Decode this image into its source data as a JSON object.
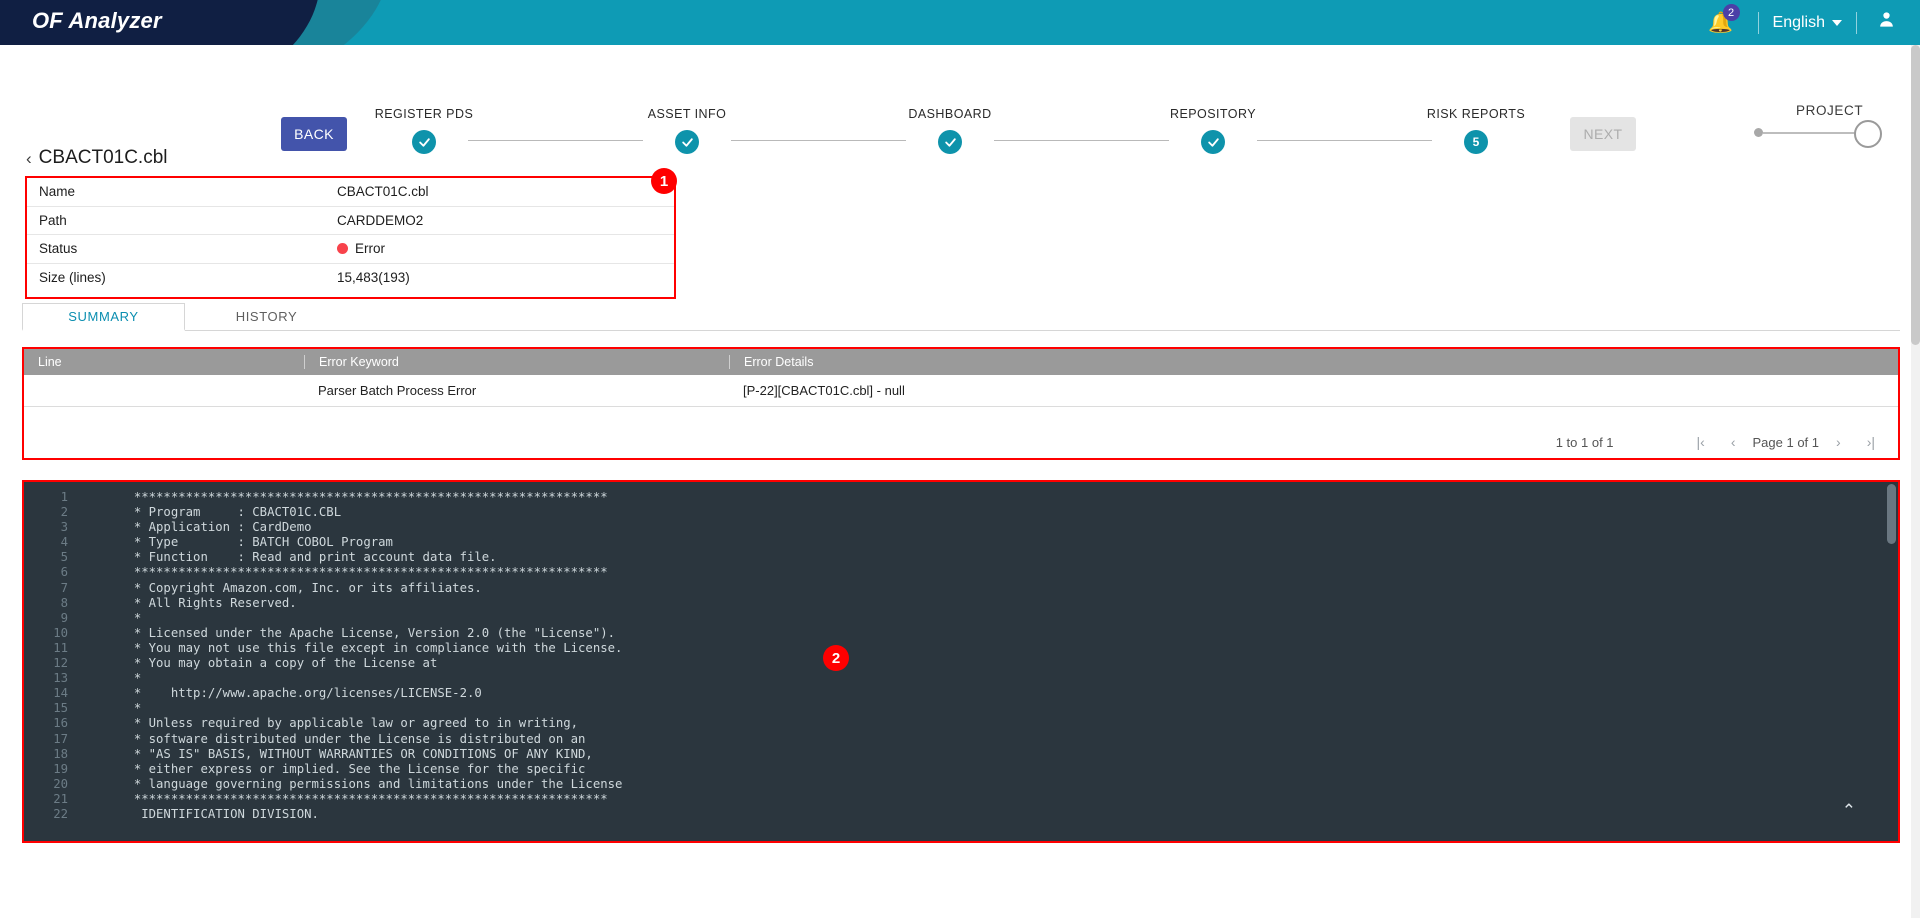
{
  "app": {
    "brand": "OF Analyzer",
    "notifications_count": "2",
    "language": "English",
    "icons": {
      "bell": "bell-icon",
      "user": "user-icon",
      "caret": "chevron-down-icon"
    }
  },
  "stepper": {
    "back_label": "BACK",
    "next_label": "NEXT",
    "steps": [
      {
        "label": "REGISTER PDS",
        "state": "done",
        "marker": "✓"
      },
      {
        "label": "ASSET INFO",
        "state": "done",
        "marker": "✓"
      },
      {
        "label": "DASHBOARD",
        "state": "done",
        "marker": "✓"
      },
      {
        "label": "REPOSITORY",
        "state": "done",
        "marker": "✓"
      },
      {
        "label": "RISK REPORTS",
        "state": "current",
        "marker": "5"
      }
    ],
    "project_toggle_label": "PROJECT"
  },
  "file": {
    "title": "CBACT01C.cbl",
    "back_chevron": "‹",
    "info_rows": [
      {
        "key": "Name",
        "value": "CBACT01C.cbl",
        "status": false
      },
      {
        "key": "Path",
        "value": "CARDDEMO2",
        "status": false
      },
      {
        "key": "Status",
        "value": "Error",
        "status": true
      },
      {
        "key": "Size (lines)",
        "value": "15,483(193)",
        "status": false
      }
    ],
    "status_color": "#f8424b"
  },
  "tabs": [
    {
      "label": "SUMMARY",
      "active": true
    },
    {
      "label": "HISTORY",
      "active": false
    }
  ],
  "error_table": {
    "columns": [
      "Line",
      "Error Keyword",
      "Error Details"
    ],
    "rows": [
      {
        "line": "",
        "keyword": "Parser Batch Process Error",
        "details": "[P-22][CBACT01C.cbl] - null"
      }
    ],
    "pager": {
      "count_text": "1 to 1 of 1",
      "first": "|‹",
      "prev": "‹",
      "page_text": "Page 1 of 1",
      "next": "›",
      "last": "›|"
    }
  },
  "code": {
    "lines": [
      {
        "n": "1",
        "t": "       ****************************************************************"
      },
      {
        "n": "2",
        "t": "       * Program     : CBACT01C.CBL"
      },
      {
        "n": "3",
        "t": "       * Application : CardDemo"
      },
      {
        "n": "4",
        "t": "       * Type        : BATCH COBOL Program"
      },
      {
        "n": "5",
        "t": "       * Function    : Read and print account data file."
      },
      {
        "n": "6",
        "t": "       ****************************************************************"
      },
      {
        "n": "7",
        "t": "       * Copyright Amazon.com, Inc. or its affiliates."
      },
      {
        "n": "8",
        "t": "       * All Rights Reserved."
      },
      {
        "n": "9",
        "t": "       *"
      },
      {
        "n": "10",
        "t": "       * Licensed under the Apache License, Version 2.0 (the \"License\")."
      },
      {
        "n": "11",
        "t": "       * You may not use this file except in compliance with the License."
      },
      {
        "n": "12",
        "t": "       * You may obtain a copy of the License at"
      },
      {
        "n": "13",
        "t": "       *"
      },
      {
        "n": "14",
        "t": "       *    http://www.apache.org/licenses/LICENSE-2.0"
      },
      {
        "n": "15",
        "t": "       *"
      },
      {
        "n": "16",
        "t": "       * Unless required by applicable law or agreed to in writing,"
      },
      {
        "n": "17",
        "t": "       * software distributed under the License is distributed on an"
      },
      {
        "n": "18",
        "t": "       * \"AS IS\" BASIS, WITHOUT WARRANTIES OR CONDITIONS OF ANY KIND,"
      },
      {
        "n": "19",
        "t": "       * either express or implied. See the License for the specific"
      },
      {
        "n": "20",
        "t": "       * language governing permissions and limitations under the License"
      },
      {
        "n": "21",
        "t": "       ****************************************************************"
      },
      {
        "n": "22",
        "t": "        IDENTIFICATION DIVISION."
      }
    ],
    "collapse_icon": "⌃"
  },
  "annotations": [
    {
      "id": "1",
      "label": "1"
    },
    {
      "id": "2",
      "label": "2"
    }
  ],
  "colors": {
    "brand_teal": "#0e9bb5",
    "brand_navy": "#101f43",
    "accent_red": "#ff0000",
    "step_teal": "#0e93ab",
    "back_blue": "#4354ab",
    "code_bg": "#2b363e"
  }
}
